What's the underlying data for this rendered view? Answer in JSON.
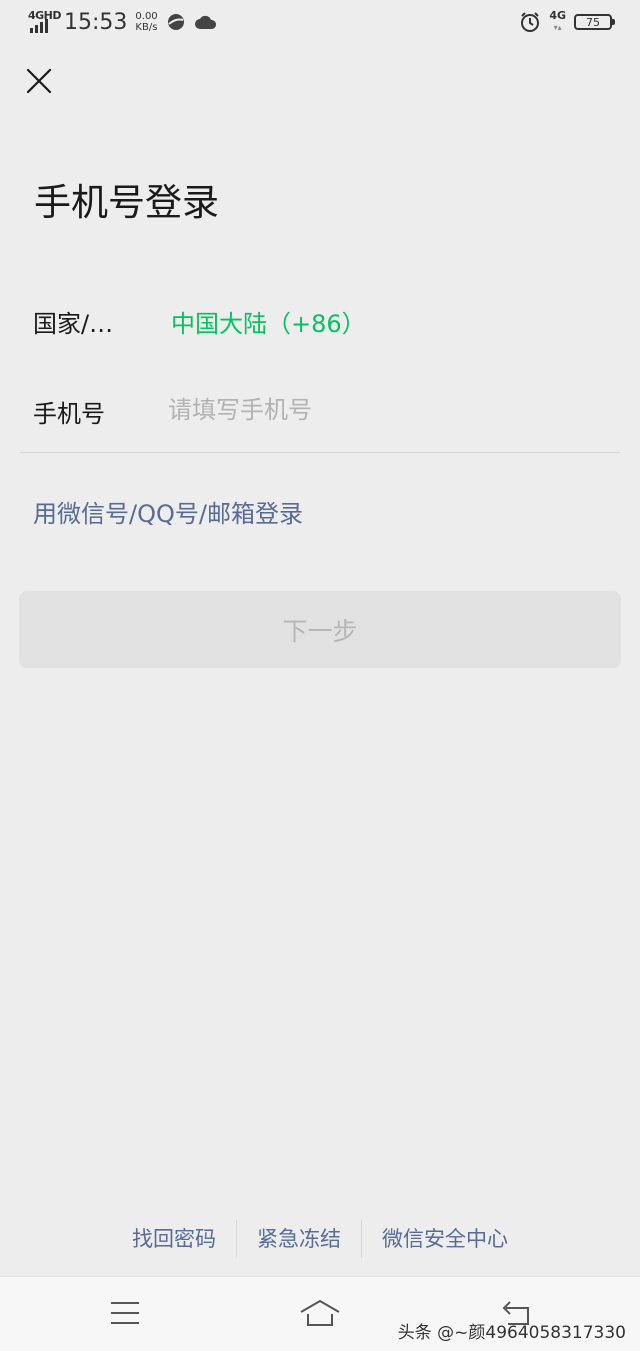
{
  "status_bar": {
    "network": "4GHD",
    "time": "15:53",
    "speed_value": "0.00",
    "speed_unit": "KB/s",
    "right_network": "4G",
    "battery": "75"
  },
  "header": {
    "close_icon": "close-icon",
    "title": "手机号登录"
  },
  "form": {
    "country_label": "国家/…",
    "country_value": "中国大陆（+86）",
    "phone_label": "手机号",
    "phone_placeholder": "请填写手机号",
    "phone_value": ""
  },
  "alt_login_link": "用微信号/QQ号/邮箱登录",
  "next_button": "下一步",
  "footer": {
    "links": [
      "找回密码",
      "紧急冻结",
      "微信安全中心"
    ]
  },
  "nav_bar": {
    "icons": [
      "menu-icon",
      "home-icon",
      "back-icon"
    ]
  },
  "watermark": "头条 @~颜4964058317330",
  "colors": {
    "background": "#ededed",
    "accent_green": "#07c160",
    "link_blue": "#576b95",
    "button_disabled_bg": "#e1e1e1",
    "button_disabled_text": "#b6b6b6"
  }
}
